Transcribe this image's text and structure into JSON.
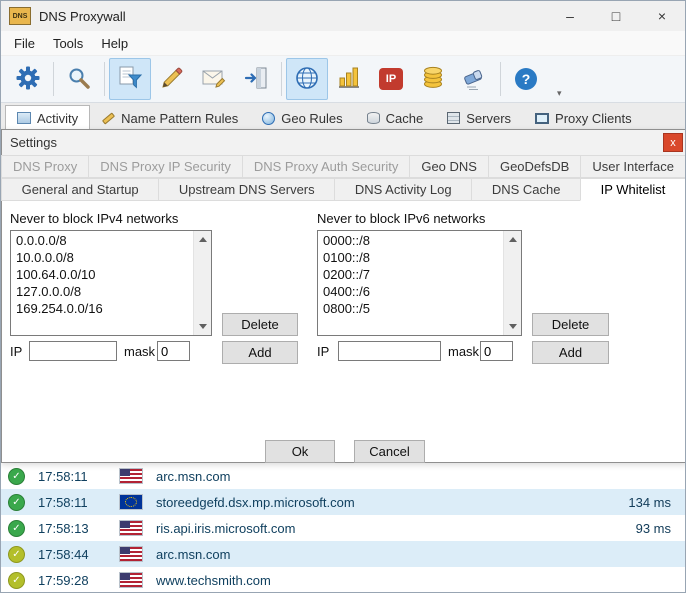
{
  "window": {
    "title": "DNS Proxywall",
    "icon_text": "DNS",
    "minimize_glyph": "–",
    "maximize_glyph": "□",
    "close_glyph": "×"
  },
  "menu": {
    "items": [
      {
        "label": "File"
      },
      {
        "label": "Tools"
      },
      {
        "label": "Help"
      }
    ]
  },
  "toolbar": {
    "ip_icon_text": "IP",
    "help_glyph": "?",
    "overflow_glyph": "▾"
  },
  "main_tabs": {
    "items": [
      {
        "label": "Activity"
      },
      {
        "label": "Name Pattern Rules"
      },
      {
        "label": "Geo Rules"
      },
      {
        "label": "Cache"
      },
      {
        "label": "Servers"
      },
      {
        "label": "Proxy Clients"
      }
    ]
  },
  "dialog": {
    "title": "Settings",
    "close_glyph": "x",
    "tabs_row1": [
      "DNS Proxy",
      "DNS Proxy IP Security",
      "DNS Proxy Auth Security",
      "Geo DNS",
      "GeoDefsDB",
      "User Interface"
    ],
    "tabs_row2": [
      "General and Startup",
      "Upstream DNS Servers",
      "DNS Activity Log",
      "DNS Cache",
      "IP Whitelist"
    ],
    "active_tab": "IP Whitelist",
    "ipv4": {
      "label": "Never to block IPv4 networks",
      "items": [
        "0.0.0.0/8",
        "10.0.0.0/8",
        "100.64.0.0/10",
        "127.0.0.0/8",
        "169.254.0.0/16"
      ],
      "delete_label": "Delete",
      "ip_label": "IP",
      "ip_value": "",
      "mask_label": "mask",
      "mask_value": "0",
      "add_label": "Add"
    },
    "ipv6": {
      "label": "Never to block IPv6 networks",
      "items": [
        "0000::/8",
        "0100::/8",
        "0200::/7",
        "0400::/6",
        "0800::/5"
      ],
      "delete_label": "Delete",
      "ip_label": "IP",
      "ip_value": "",
      "mask_label": "mask",
      "mask_value": "0",
      "add_label": "Add"
    },
    "ok_label": "Ok",
    "cancel_label": "Cancel"
  },
  "activity": {
    "rows": [
      {
        "time": "17:58:11",
        "flag": "us",
        "domain": "arc.msn.com",
        "latency": "",
        "status": "ok"
      },
      {
        "time": "17:58:11",
        "flag": "eu",
        "domain": "storeedgefd.dsx.mp.microsoft.com",
        "latency": "134 ms",
        "status": "ok"
      },
      {
        "time": "17:58:13",
        "flag": "us",
        "domain": "ris.api.iris.microsoft.com",
        "latency": "93 ms",
        "status": "ok"
      },
      {
        "time": "17:58:44",
        "flag": "us",
        "domain": "arc.msn.com",
        "latency": "",
        "status": "warn"
      },
      {
        "time": "17:59:28",
        "flag": "us",
        "domain": "www.techsmith.com",
        "latency": "",
        "status": "warn"
      }
    ]
  },
  "colors": {
    "accent_blue": "#2e6db4",
    "row_alt": "#dcedf8",
    "status_ok": "#3aa84c",
    "status_warn": "#b3bf2b",
    "dialog_close": "#d9482b"
  }
}
